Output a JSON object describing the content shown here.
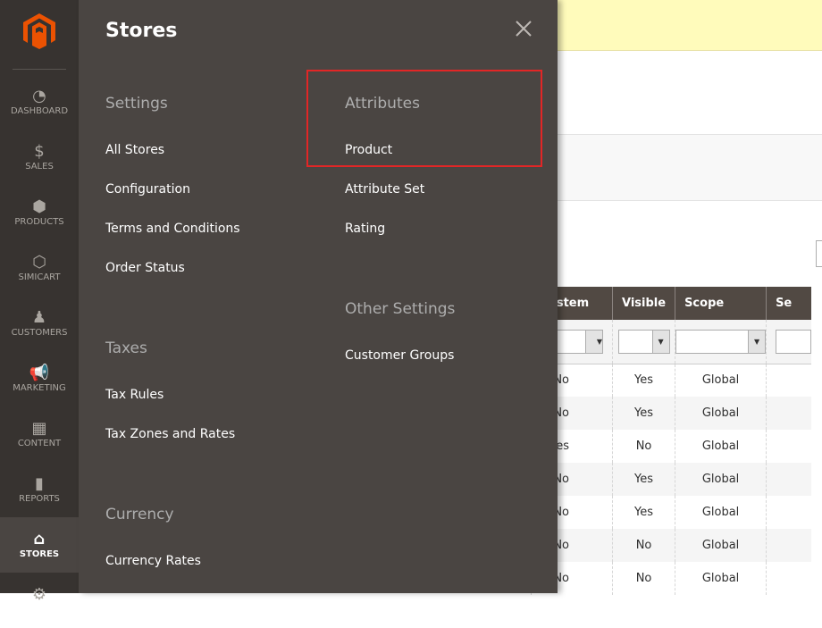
{
  "sidebar": {
    "items": [
      {
        "label": "DASHBOARD",
        "icon": "dashboard-icon"
      },
      {
        "label": "SALES",
        "icon": "dollar-icon"
      },
      {
        "label": "PRODUCTS",
        "icon": "box-icon"
      },
      {
        "label": "SIMICART",
        "icon": "hexagon-icon"
      },
      {
        "label": "CUSTOMERS",
        "icon": "person-icon"
      },
      {
        "label": "MARKETING",
        "icon": "megaphone-icon"
      },
      {
        "label": "CONTENT",
        "icon": "layout-icon"
      },
      {
        "label": "REPORTS",
        "icon": "bar-chart-icon"
      },
      {
        "label": "STORES",
        "icon": "storefront-icon",
        "active": true
      },
      {
        "label": "",
        "icon": "gear-icon"
      }
    ]
  },
  "panel": {
    "title": "Stores",
    "settings": {
      "heading": "Settings",
      "items": [
        "All Stores",
        "Configuration",
        "Terms and Conditions",
        "Order Status"
      ]
    },
    "taxes": {
      "heading": "Taxes",
      "items": [
        "Tax Rules",
        "Tax Zones and Rates"
      ]
    },
    "currency": {
      "heading": "Currency",
      "items": [
        "Currency Rates"
      ]
    },
    "attributes": {
      "heading": "Attributes",
      "items": [
        "Product",
        "Attribute Set",
        "Rating"
      ]
    },
    "other": {
      "heading": "Other Settings",
      "items": [
        "Customer Groups"
      ]
    }
  },
  "table": {
    "headers": [
      "System",
      "Visible",
      "Scope",
      "Se"
    ],
    "rows": [
      [
        "No",
        "Yes",
        "Global"
      ],
      [
        "No",
        "Yes",
        "Global"
      ],
      [
        "Yes",
        "No",
        "Global"
      ],
      [
        "No",
        "Yes",
        "Global"
      ],
      [
        "No",
        "Yes",
        "Global"
      ],
      [
        "No",
        "No",
        "Global"
      ],
      [
        "No",
        "No",
        "Global"
      ]
    ]
  },
  "colors": {
    "accent": "#eb5202",
    "highlight": "#e22626"
  }
}
